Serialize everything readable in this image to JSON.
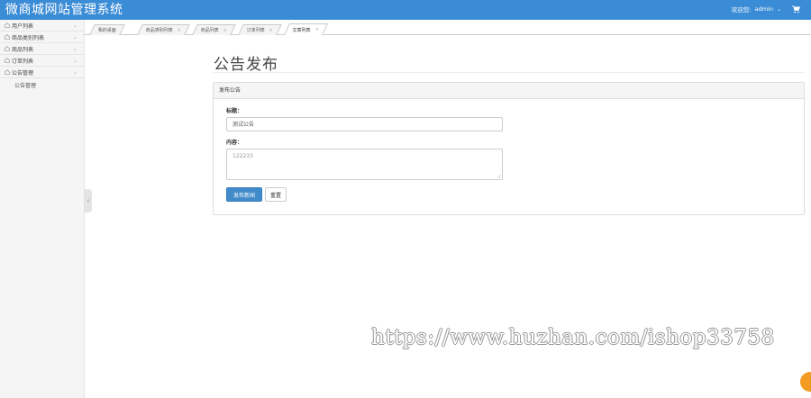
{
  "app": {
    "title": "微商城网站管理系统",
    "welcome": "欢迎您:",
    "username": "admin",
    "accent_color": "#3b8cd6"
  },
  "sidebar": {
    "items": [
      {
        "label": "用户列表",
        "icon": "home-icon"
      },
      {
        "label": "商品类别列表",
        "icon": "home-icon"
      },
      {
        "label": "商品列表",
        "icon": "home-icon"
      },
      {
        "label": "订单列表",
        "icon": "home-icon"
      },
      {
        "label": "公告管理",
        "icon": "home-icon",
        "expanded": true
      }
    ],
    "sub_items": [
      {
        "label": "公告管理"
      }
    ]
  },
  "tabs": [
    {
      "label": "我的桌面",
      "closable": false
    },
    {
      "label": "商品类别列表",
      "closable": true
    },
    {
      "label": "商品列表",
      "closable": true
    },
    {
      "label": "订单列表",
      "closable": true
    },
    {
      "label": "文章列表",
      "closable": true,
      "active": true
    }
  ],
  "main": {
    "page_title": "公告发布",
    "panel_title": "发布公告",
    "title_label": "标题：",
    "title_value": "测试公告",
    "content_label": "内容：",
    "content_value": "122233",
    "submit_label": "发布新闻",
    "reset_label": "重置"
  },
  "watermark": "https://www.huzhan.com/ishop33758"
}
